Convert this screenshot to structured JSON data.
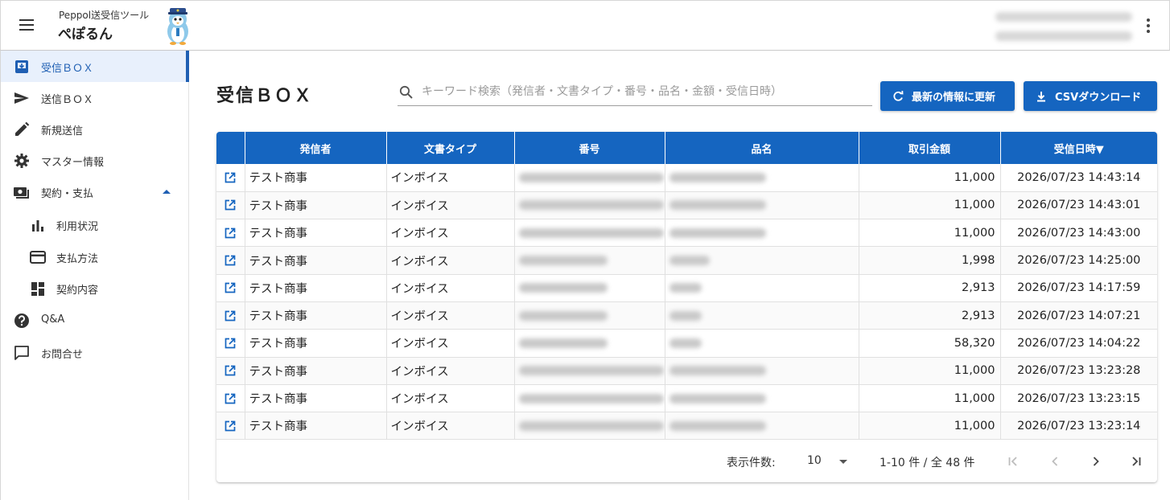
{
  "header": {
    "app_subtitle": "Peppol送受信ツール",
    "app_name": "ぺぽるん",
    "icons": {
      "menu": "hamburger-menu-icon",
      "more": "kebab-more-icon",
      "mascot": "penguin-mascot"
    }
  },
  "sidebar": {
    "items": [
      {
        "label": "受信ＢＯＸ",
        "icon": "inbox-icon",
        "active": true
      },
      {
        "label": "送信ＢＯＸ",
        "icon": "send-icon",
        "active": false
      },
      {
        "label": "新規送信",
        "icon": "pencil-icon",
        "active": false
      },
      {
        "label": "マスター情報",
        "icon": "gear-icon",
        "active": false
      },
      {
        "label": "契約・支払",
        "icon": "payments-icon",
        "active": false,
        "expanded": true
      },
      {
        "label": "利用状況",
        "icon": "bar-chart-icon",
        "sub": true
      },
      {
        "label": "支払方法",
        "icon": "credit-card-icon",
        "sub": true
      },
      {
        "label": "契約内容",
        "icon": "dashboard-icon",
        "sub": true
      },
      {
        "label": "Q&A",
        "icon": "help-icon",
        "active": false
      },
      {
        "label": "お問合せ",
        "icon": "chat-icon",
        "active": false
      }
    ]
  },
  "main": {
    "title": "受信ＢＯＸ",
    "search": {
      "placeholder": "キーワード検索（発信者・文書タイプ・番号・品名・金額・受信日時）",
      "value": ""
    },
    "refresh_button": "最新の情報に更新",
    "csv_button": "CSVダウンロード",
    "accent_color": "#1565c0"
  },
  "table": {
    "columns": [
      "",
      "発信者",
      "文書タイプ",
      "番号",
      "品名",
      "取引金額",
      "受信日時▼"
    ],
    "rows": [
      {
        "sender": "テスト商事",
        "doc_type": "インボイス",
        "amount": "11,000",
        "received": "2026/07/23 14:43:14"
      },
      {
        "sender": "テスト商事",
        "doc_type": "インボイス",
        "amount": "11,000",
        "received": "2026/07/23 14:43:01"
      },
      {
        "sender": "テスト商事",
        "doc_type": "インボイス",
        "amount": "11,000",
        "received": "2026/07/23 14:43:00"
      },
      {
        "sender": "テスト商事",
        "doc_type": "インボイス",
        "amount": "1,998",
        "received": "2026/07/23 14:25:00"
      },
      {
        "sender": "テスト商事",
        "doc_type": "インボイス",
        "amount": "2,913",
        "received": "2026/07/23 14:17:59"
      },
      {
        "sender": "テスト商事",
        "doc_type": "インボイス",
        "amount": "2,913",
        "received": "2026/07/23 14:07:21"
      },
      {
        "sender": "テスト商事",
        "doc_type": "インボイス",
        "amount": "58,320",
        "received": "2026/07/23 14:04:22"
      },
      {
        "sender": "テスト商事",
        "doc_type": "インボイス",
        "amount": "11,000",
        "received": "2026/07/23 13:23:28"
      },
      {
        "sender": "テスト商事",
        "doc_type": "インボイス",
        "amount": "11,000",
        "received": "2026/07/23 13:23:15"
      },
      {
        "sender": "テスト商事",
        "doc_type": "インボイス",
        "amount": "11,000",
        "received": "2026/07/23 13:23:14"
      }
    ]
  },
  "pagination": {
    "rows_per_page_label": "表示件数:",
    "rows_per_page": "10",
    "range": "1-10 件 / 全 48 件",
    "icons": [
      "first-page-icon",
      "prev-page-icon",
      "next-page-icon",
      "last-page-icon"
    ]
  }
}
